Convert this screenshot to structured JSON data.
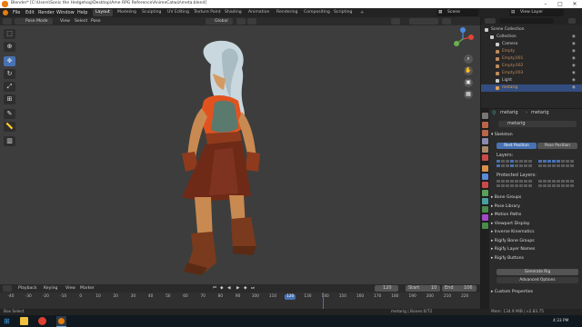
{
  "window": {
    "title": "Blender* [C:\\Users\\Sonic the Hedgehog\\Desktop\\Ame RPG Reference\\AnimeCatwiz\\meta.blend]"
  },
  "menu": [
    "File",
    "Edit",
    "Render",
    "Window",
    "Help"
  ],
  "workspaces": {
    "items": [
      "Layout",
      "Modeling",
      "Sculpting",
      "UV Editing",
      "Texture Paint",
      "Shading",
      "Animation",
      "Rendering",
      "Compositing",
      "Scripting"
    ],
    "active": "Layout"
  },
  "scene": {
    "name": "Scene",
    "view_layer": "View Layer"
  },
  "viewport_header": {
    "mode": "Pose Mode",
    "view": "View",
    "select": "Select",
    "pose": "Pose",
    "orientation": "Global"
  },
  "outliner": {
    "rows": [
      {
        "label": "Scene Collection",
        "color": "#cccccc"
      },
      {
        "label": "Collection",
        "color": "#cccccc"
      },
      {
        "label": "Camera",
        "color": "#cccccc"
      },
      {
        "label": "Empty",
        "color": "#c08a5a"
      },
      {
        "label": "Empty.001",
        "color": "#c08a5a"
      },
      {
        "label": "Empty.002",
        "color": "#c08a5a"
      },
      {
        "label": "Empty.003",
        "color": "#c08a5a"
      },
      {
        "label": "Light",
        "color": "#cccccc"
      },
      {
        "label": "metarig",
        "color": "#e0a050"
      }
    ]
  },
  "properties": {
    "object_name": "metarig",
    "data_name": "metarig",
    "data_field": "metarig",
    "skeleton": "Skeleton",
    "rest_position": "Rest Position",
    "pose_position": "Pose Position",
    "layers": "Layers:",
    "protected_layers": "Protected Layers:",
    "panels": [
      "Bone Groups",
      "Pose Library",
      "Motion Paths",
      "Viewport Display",
      "Inverse Kinematics",
      "Rigify Bone Groups",
      "Rigify Layer Names",
      "Rigify Buttons"
    ],
    "generate_rig": "Generate Rig",
    "advanced_options": "Advanced Options",
    "custom_properties": "Custom Properties"
  },
  "timeline": {
    "playback": "Playback",
    "keying": "Keying",
    "view": "View",
    "marker": "Marker",
    "current_frame": "120",
    "start_label": "Start",
    "start": "10",
    "end_label": "End",
    "end": "106",
    "ticks": [
      "-40",
      "-30",
      "-20",
      "-10",
      "0",
      "10",
      "20",
      "30",
      "40",
      "50",
      "60",
      "70",
      "80",
      "90",
      "100",
      "110",
      "120",
      "130",
      "140",
      "150",
      "160",
      "170",
      "180",
      "190",
      "200",
      "210",
      "220"
    ]
  },
  "statusbar": {
    "left": "Box Select",
    "mid": "metarig | Bones:0/72",
    "right": "Mem: 134.9 MiB | v2.83.75"
  },
  "taskbar": {
    "clock": "4:33 PM"
  },
  "colors": {
    "accent": "#4772b3",
    "active_frame": "#4772b3"
  }
}
